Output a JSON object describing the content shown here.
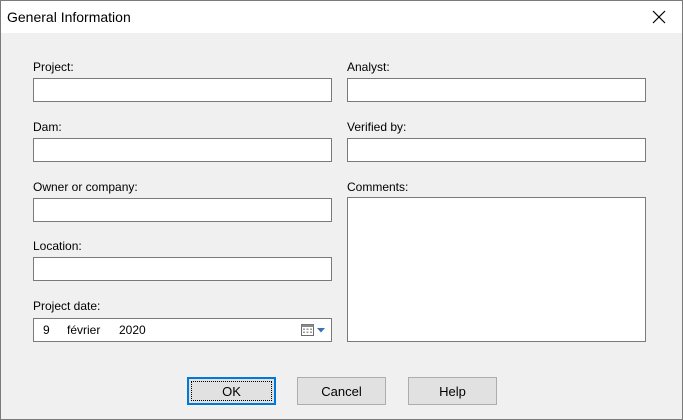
{
  "window": {
    "title": "General Information"
  },
  "fields": {
    "project": {
      "label": "Project:",
      "value": ""
    },
    "dam": {
      "label": "Dam:",
      "value": ""
    },
    "owner": {
      "label": "Owner or company:",
      "value": ""
    },
    "location": {
      "label": "Location:",
      "value": ""
    },
    "project_date": {
      "label": "Project date:",
      "day": "9",
      "month": "février",
      "year": "2020"
    },
    "analyst": {
      "label": "Analyst:",
      "value": ""
    },
    "verified_by": {
      "label": "Verified by:",
      "value": ""
    },
    "comments": {
      "label": "Comments:",
      "value": ""
    }
  },
  "buttons": {
    "ok": "OK",
    "cancel": "Cancel",
    "help": "Help"
  },
  "icons": {
    "close": "close-icon",
    "calendar": "calendar-icon",
    "dropdown": "chevron-down-icon"
  },
  "colors": {
    "accent": "#0078d7",
    "titlebar": "#ffffff",
    "dialog_bg": "#f0f0f0"
  }
}
